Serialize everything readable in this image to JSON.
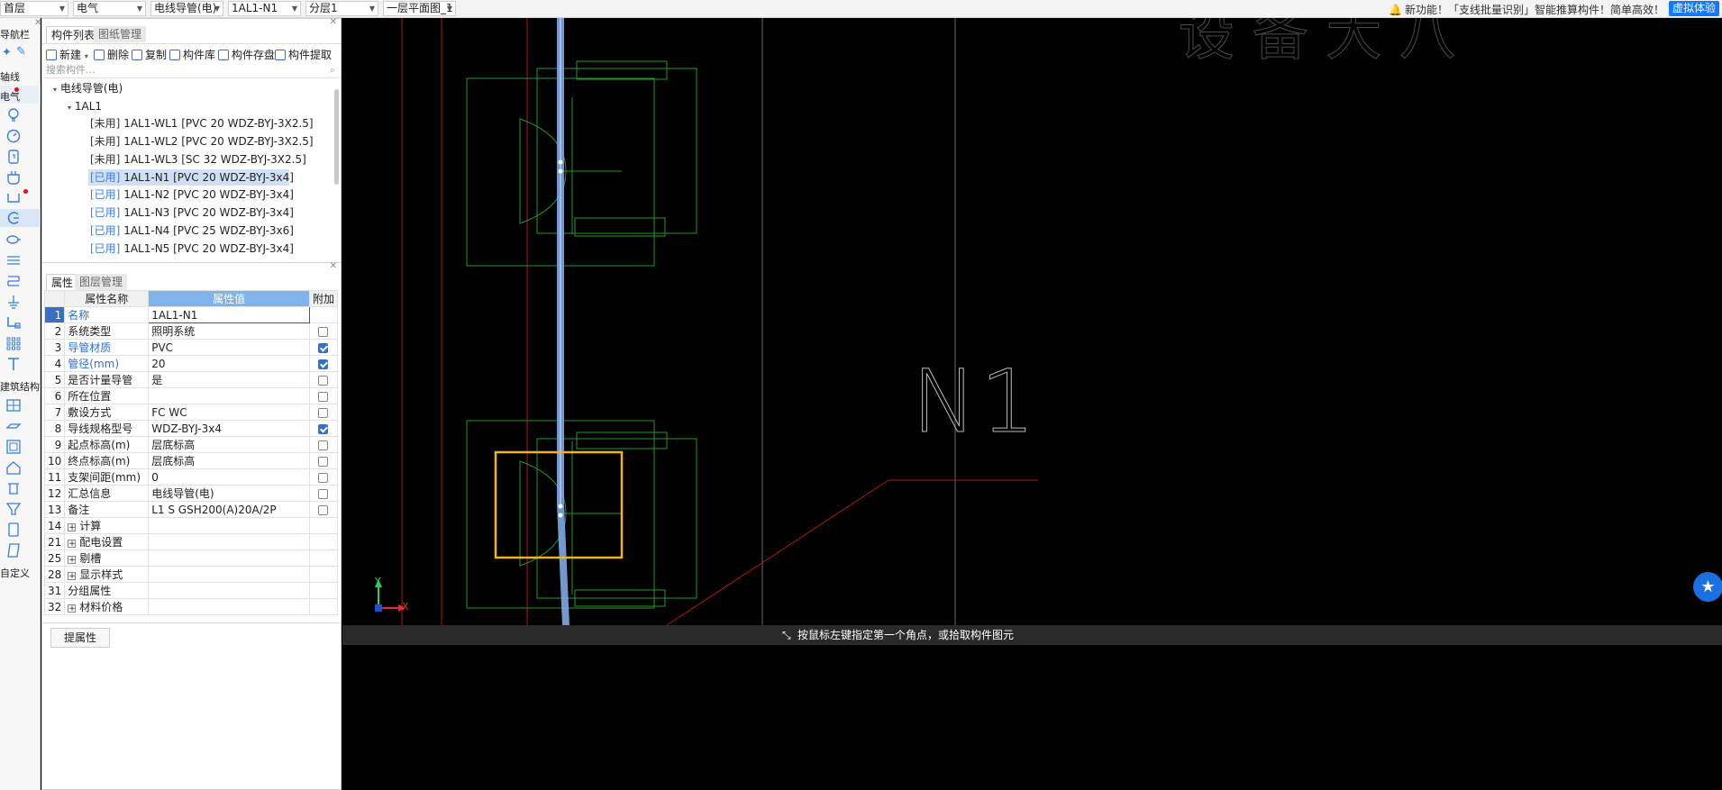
{
  "topbar": {
    "combos": [
      {
        "value": "首层"
      },
      {
        "value": "电气"
      },
      {
        "value": "电线导管(电)"
      },
      {
        "value": "1AL1-N1"
      },
      {
        "value": "分层1"
      },
      {
        "value": "一层平面图_1"
      }
    ],
    "notice": "新功能！「支线批量识别」智能推算构件！简单高效！",
    "trial_button": "虚拟体验"
  },
  "leftnav": {
    "title": "导航栏",
    "items": [
      "轴线",
      "电气",
      "建筑结构",
      "自定义"
    ],
    "accent": "#3a7de0"
  },
  "component_panel": {
    "tabs": [
      "构件列表",
      "图纸管理"
    ],
    "toolbar": [
      "新建",
      "删除",
      "复制",
      "构件库",
      "构件存盘",
      "构件提取"
    ],
    "search_placeholder": "搜索构件...",
    "tree_root": "电线导管(电)",
    "tree_group": "1AL1",
    "items": [
      {
        "status": "[未用]",
        "label": "1AL1-WL1 [PVC 20 WDZ-BYJ-3X2.5]"
      },
      {
        "status": "[未用]",
        "label": "1AL1-WL2 [PVC 20 WDZ-BYJ-3X2.5]"
      },
      {
        "status": "[未用]",
        "label": "1AL1-WL3 [SC 32 WDZ-BYJ-3X2.5]"
      },
      {
        "status": "[已用]",
        "label": "1AL1-N1 [PVC 20 WDZ-BYJ-3x4]"
      },
      {
        "status": "[已用]",
        "label": "1AL1-N2 [PVC 20 WDZ-BYJ-3x4]"
      },
      {
        "status": "[已用]",
        "label": "1AL1-N3 [PVC 20 WDZ-BYJ-3x4]"
      },
      {
        "status": "[已用]",
        "label": "1AL1-N4 [PVC 25 WDZ-BYJ-3x6]"
      },
      {
        "status": "[已用]",
        "label": "1AL1-N5 [PVC 20 WDZ-BYJ-3x4]"
      }
    ]
  },
  "property_panel": {
    "tabs": [
      "属性",
      "图层管理"
    ],
    "headers": [
      "属性名称",
      "属性值",
      "附加"
    ],
    "rows": [
      {
        "n": "1",
        "name": "名称",
        "value": "1AL1-N1"
      },
      {
        "n": "2",
        "name": "系统类型",
        "value": "照明系统"
      },
      {
        "n": "3",
        "name": "导管材质",
        "value": "PVC"
      },
      {
        "n": "4",
        "name": "管径(mm)",
        "value": "20"
      },
      {
        "n": "5",
        "name": "是否计量导管",
        "value": "是"
      },
      {
        "n": "6",
        "name": "所在位置",
        "value": ""
      },
      {
        "n": "7",
        "name": "敷设方式",
        "value": "FC WC"
      },
      {
        "n": "8",
        "name": "导线规格型号",
        "value": "WDZ-BYJ-3x4"
      },
      {
        "n": "9",
        "name": "起点标高(m)",
        "value": "层底标高"
      },
      {
        "n": "10",
        "name": "终点标高(m)",
        "value": "层底标高"
      },
      {
        "n": "11",
        "name": "支架间距(mm)",
        "value": "0"
      },
      {
        "n": "12",
        "name": "汇总信息",
        "value": "电线导管(电)"
      },
      {
        "n": "13",
        "name": "备注",
        "value": "L1 S GSH200(A)20A/2P"
      },
      {
        "n": "14",
        "name": "计算",
        "value": ""
      },
      {
        "n": "21",
        "name": "配电设置",
        "value": ""
      },
      {
        "n": "25",
        "name": "剔槽",
        "value": ""
      },
      {
        "n": "28",
        "name": "显示样式",
        "value": ""
      },
      {
        "n": "31",
        "name": "分组属性",
        "value": ""
      },
      {
        "n": "32",
        "name": "材料价格",
        "value": ""
      }
    ],
    "get_button": "提属性"
  },
  "canvas": {
    "label_text": "N1",
    "axis_y": "Y",
    "axis_x": "X",
    "status_text": "按鼠标左键指定第一个角点，或拾取构件图元",
    "line_color_green": "#1f9a2a",
    "line_color_red": "#c02020",
    "selection_color": "#f2b21a",
    "pipe_color": "#7ea8e6"
  }
}
